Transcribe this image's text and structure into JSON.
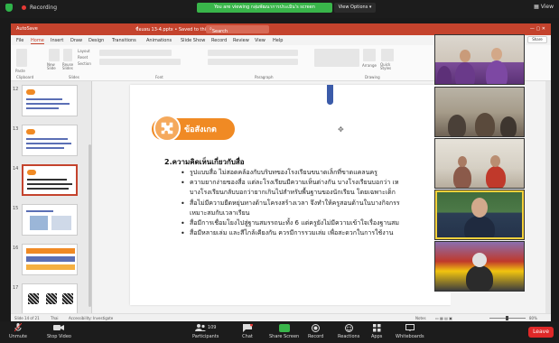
{
  "zoom_top": {
    "recording_label": "Recording",
    "viewing_banner": "You are viewing กลุ่มพัฒนาการประเมิน's screen",
    "view_options": "View Options",
    "view_button": "View"
  },
  "ppt": {
    "autosave": "AutoSave",
    "filename": "ชื่อแผน 13-4.pptx • Saved to this PC",
    "search_placeholder": "Search",
    "tabs": [
      "File",
      "Home",
      "Insert",
      "Draw",
      "Design",
      "Transitions",
      "Animations",
      "Slide Show",
      "Record",
      "Review",
      "View",
      "Help"
    ],
    "share_label": "Share",
    "ribbon_groups": [
      "Clipboard",
      "Slides",
      "Font",
      "Paragraph",
      "Drawing"
    ],
    "ribbon_buttons": [
      "Paste",
      "New Slide",
      "Reuse Slides",
      "Layout",
      "Reset",
      "Section",
      "Arrange",
      "Quick Styles"
    ],
    "thumb_numbers": [
      "12",
      "13",
      "14",
      "15",
      "16",
      "17"
    ],
    "status": {
      "slide_info": "Slide 14 of 21",
      "language": "Thai",
      "accessibility": "Accessibility: Investigate",
      "notes": "Notes",
      "zoom": "80%"
    }
  },
  "slide": {
    "badge_text": "ข้อสังเกต",
    "heading": "2.ความคิดเห็นเกี่ยวกับสื่อ",
    "bullets": [
      {
        "text": "รูปแบบสื่อ ไม่สอดคล้องกับบริบทของโรงเรียนขนาดเล็กที่ขาดแคลนครู",
        "cont": ""
      },
      {
        "text": "ความยากง่ายของสื่อ แต่ละโรงเรียนมีความเห็นต่างกัน บางโรงเรียนบอกว่า เห",
        "cont": "บางโรงเรียนกลับบอกว่ายากเกินไปสำหรับพื้นฐานของนักเรียน โดยเฉพาะเด็ก"
      },
      {
        "text": "สื่อไม่มีความยืดหยุ่นทางด้านโครงสร้างเวลา จึงทำให้ครูสอนด้านในบางกิจกรร",
        "cont": "เหมาะสมกับเวลาเรียน"
      },
      {
        "text": "สื่อมีการเชื่อมโยงไปสู่ฐานสมรรถนะทั้ง 6 แต่ครูยังไม่มีความเข้าใจเรื่องฐานสม",
        "cont": ""
      },
      {
        "text": "สื่อมีหลายเล่ม และสีไกล้เคียงกัน ควรมีการรวมเล่ม เพื่อสะดวกในการใช้งาน",
        "cont": ""
      }
    ]
  },
  "toolbar": {
    "unmute": "Unmute",
    "stop_video": "Stop Video",
    "participants": "Participants",
    "participants_count": "109",
    "chat": "Chat",
    "share_screen": "Share Screen",
    "record": "Record",
    "reactions": "Reactions",
    "apps": "Apps",
    "whiteboards": "Whiteboards",
    "leave": "Leave"
  },
  "colors": {
    "ppt_accent": "#c4432d",
    "badge_orange": "#f08a24",
    "share_green": "#39b54a",
    "leave_red": "#e02828"
  }
}
